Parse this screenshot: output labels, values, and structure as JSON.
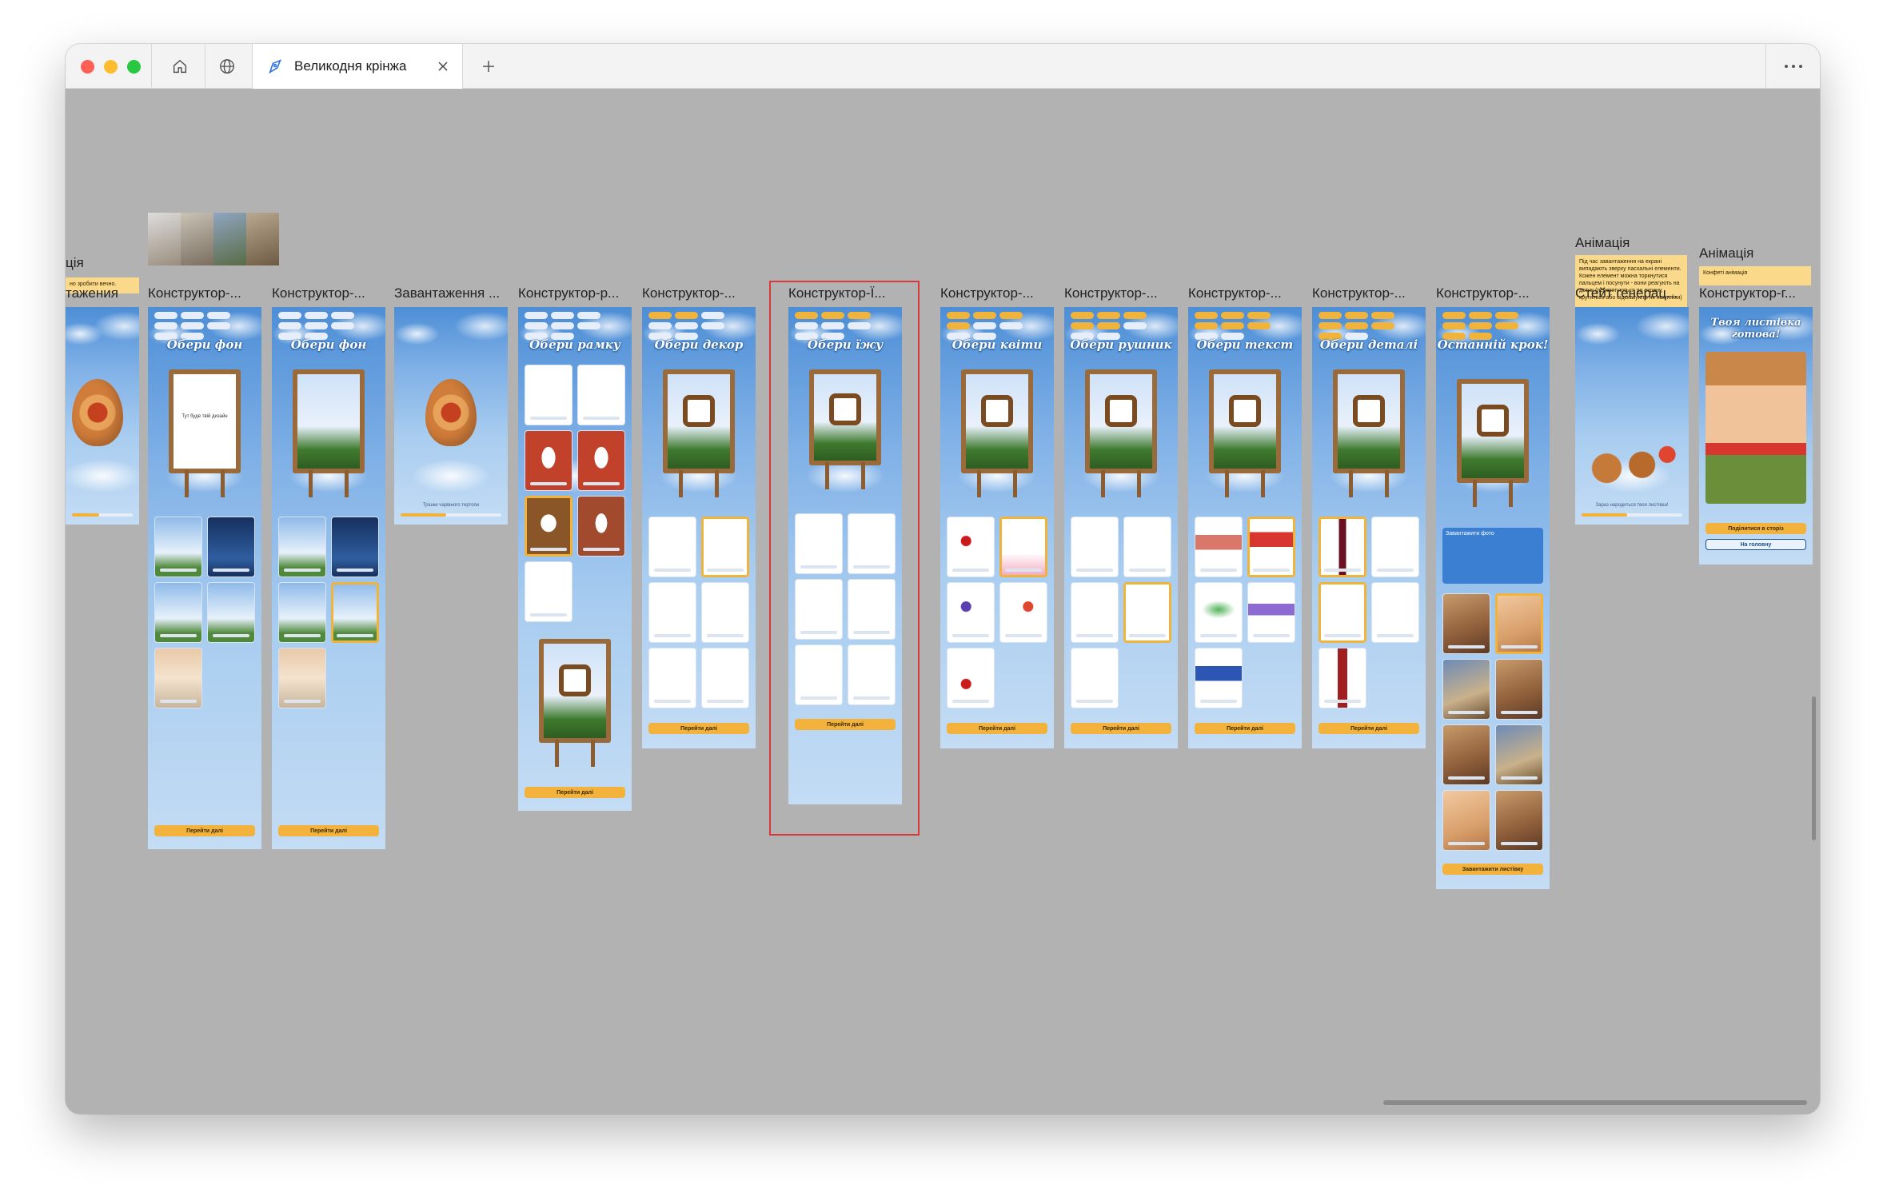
{
  "browser": {
    "tab_title": "Великодня крінжа",
    "icons": {
      "home": "home-icon",
      "globe": "globe-icon",
      "tab": "figma-pen-icon",
      "close": "close-icon",
      "new_tab": "plus-icon",
      "more": "more-dots-icon"
    }
  },
  "canvas": {
    "background": "#b2b2b2",
    "partial_labels": {
      "top": "ція",
      "bottom": "тажения"
    },
    "partial_note": "но зробити вечно.",
    "frames": [
      {
        "label": "Конструктор-...",
        "title": "Обери фон",
        "blank_text": "Тут буде твій дизайн",
        "cta": "Перейти далі"
      },
      {
        "label": "Конструктор-...",
        "title": "Обери фон",
        "cta": "Перейти далі"
      },
      {
        "label": "Завантаження ...",
        "loader_text": "Трішки чарівного тертопи"
      },
      {
        "label": "Конструктор-р...",
        "title": "Обери рамку",
        "cta": "Перейти далі"
      },
      {
        "label": "Конструктор-...",
        "title": "Обери декор",
        "cta": "Перейти далі"
      },
      {
        "label": "Конструктор-Ї...",
        "title": "Обери їжу",
        "cta": "Перейти далі"
      },
      {
        "label": "Конструктор-...",
        "title": "Обери квіти",
        "cta": "Перейти далі"
      },
      {
        "label": "Конструктор-...",
        "title": "Обери рушник",
        "cta": "Перейти далі"
      },
      {
        "label": "Конструктор-...",
        "title": "Обери текст",
        "cta": "Перейти далі"
      },
      {
        "label": "Конструктор-...",
        "title": "Обери деталі",
        "cta": "Перейти далі"
      },
      {
        "label": "Конструктор-...",
        "title": "Останній крок!",
        "upload_title": "Завантажити фото",
        "cta": "Завантажити листівку"
      },
      {
        "label": "Стейт генерац...",
        "loader_text": "Зараз народиться твоя листівка!"
      },
      {
        "label": "Конструктор-г...",
        "title": "Твоя листівка готова!",
        "share": "Поділитися в сторіз",
        "home": "На головну"
      }
    ],
    "annotations": [
      {
        "heading": "Анімація",
        "note": "Під час завантаження на екрані випадають зверху пасхальні елементи. Кожен елемент можна торкнутися пальцем і посунути - вони реагують на дотик (перетягуються по екрану, крутяться або відскакують як наклейки)"
      },
      {
        "heading": "Анімація",
        "note": "Конфеті анімація"
      }
    ]
  }
}
